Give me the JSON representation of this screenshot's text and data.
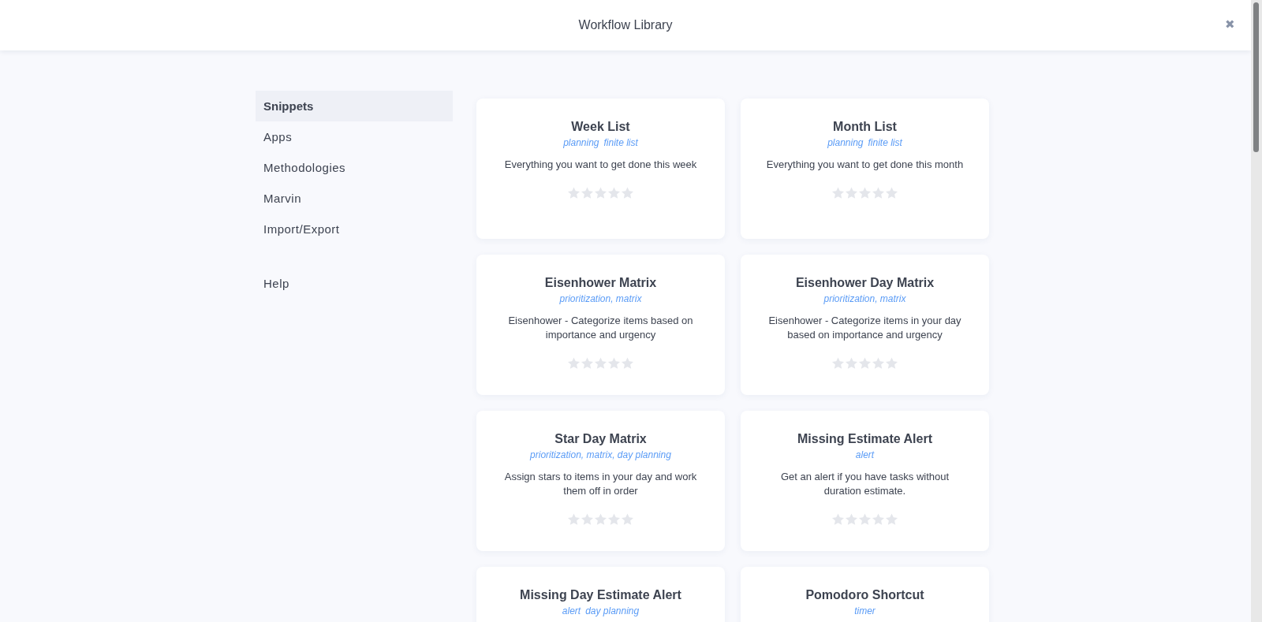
{
  "header": {
    "title": "Workflow Library",
    "close": "✖"
  },
  "sidebar": {
    "items": [
      {
        "label": "Snippets",
        "selected": true
      },
      {
        "label": "Apps",
        "selected": false
      },
      {
        "label": "Methodologies",
        "selected": false
      },
      {
        "label": "Marvin",
        "selected": false
      },
      {
        "label": "Import/Export",
        "selected": false
      }
    ],
    "footer_items": [
      {
        "label": "Help",
        "selected": false
      }
    ]
  },
  "cards": [
    {
      "title": "Week List",
      "tags": [
        "planning",
        "finite list"
      ],
      "description": "Everything you want to get done this week",
      "stars": 0
    },
    {
      "title": "Month List",
      "tags": [
        "planning",
        "finite list"
      ],
      "description": "Everything you want to get done this month",
      "stars": 0
    },
    {
      "title": "Eisenhower Matrix",
      "tags": [
        "prioritization, matrix"
      ],
      "description": "Eisenhower - Categorize items based on importance and urgency",
      "stars": 0
    },
    {
      "title": "Eisenhower Day Matrix",
      "tags": [
        "prioritization, matrix"
      ],
      "description": "Eisenhower - Categorize items in your day based on importance and urgency",
      "stars": 0
    },
    {
      "title": "Star Day Matrix",
      "tags": [
        "prioritization, matrix, day planning"
      ],
      "description": "Assign stars to items in your day and work them off in order",
      "stars": 0
    },
    {
      "title": "Missing Estimate Alert",
      "tags": [
        "alert"
      ],
      "description": "Get an alert if you have tasks without duration estimate.",
      "stars": 0
    },
    {
      "title": "Missing Day Estimate Alert",
      "tags": [
        "alert",
        "day planning"
      ]
    },
    {
      "title": "Pomodoro Shortcut",
      "tags": [
        "timer"
      ]
    }
  ]
}
